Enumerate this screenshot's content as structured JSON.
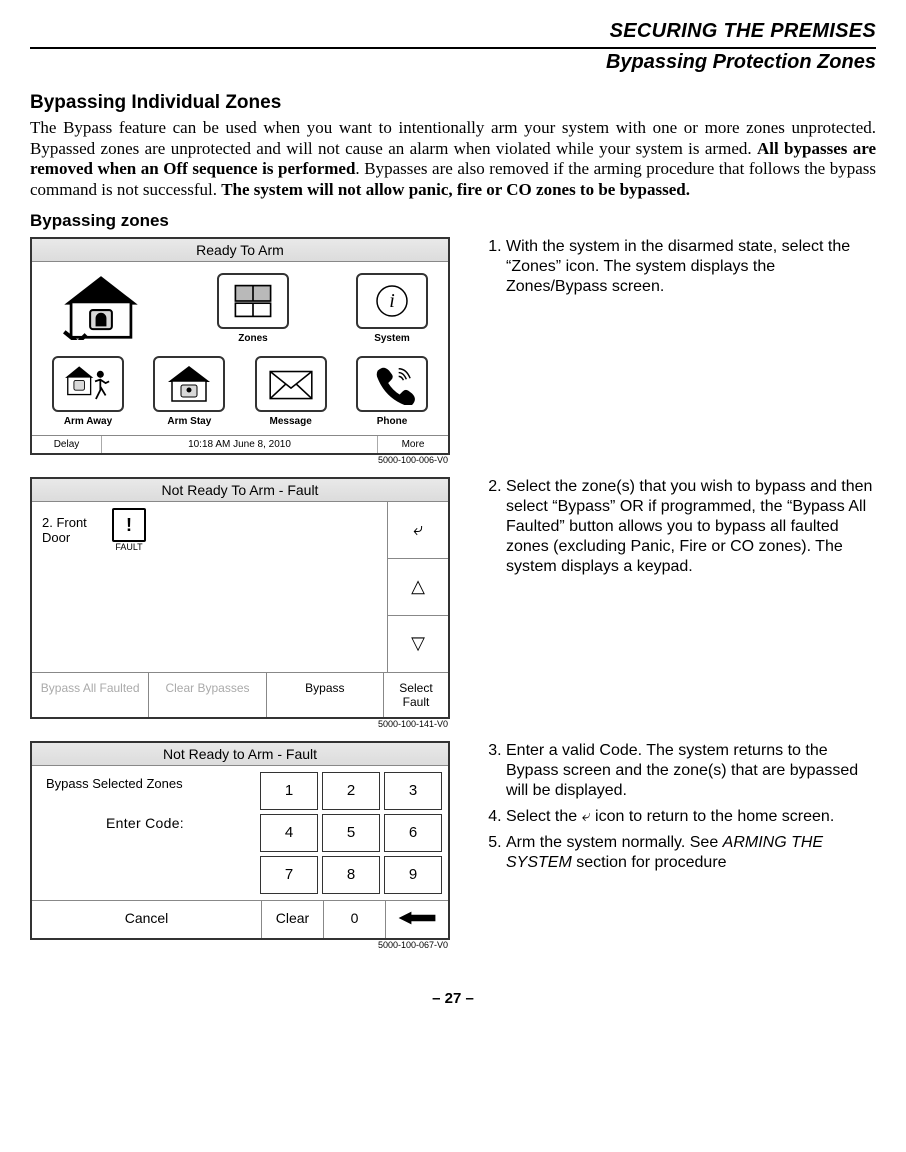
{
  "header": {
    "chapter": "SECURING THE PREMISES",
    "sub": "Bypassing Protection Zones"
  },
  "section_title": "Bypassing Individual Zones",
  "body_pre": "The Bypass feature can be used when you want to intentionally arm your system with one or more zones unprotected. Bypassed zones are unprotected and will not cause an alarm when violated while your system is armed. ",
  "body_bold1": "All bypasses are removed when an Off sequence is performed",
  "body_mid": ". Bypasses are also removed if the arming procedure that follows the bypass command is not successful. ",
  "body_bold2": "The system will not allow panic, fire or CO zones to be bypassed.",
  "subheading": "Bypassing zones",
  "panel1": {
    "title": "Ready To Arm",
    "zones_label": "Zones",
    "system_label": "System",
    "arm_away": "Arm Away",
    "arm_stay": "Arm Stay",
    "message": "Message",
    "phone": "Phone",
    "delay": "Delay",
    "datetime": "10:18 AM  June 8,  2010",
    "more": "More",
    "figcode": "5000-100-006-V0"
  },
  "step1": "With the system in the disarmed state, select the “Zones” icon. The system displays the Zones/Bypass screen.",
  "panel2": {
    "title": "Not Ready To Arm - Fault",
    "zone_name": "2. Front Door",
    "fault_label": "FAULT",
    "bypass_all": "Bypass All Faulted",
    "clear_byp": "Clear Bypasses",
    "bypass": "Bypass",
    "select_fault": "Select Fault",
    "figcode": "5000-100-141-V0"
  },
  "step2": "Select the zone(s) that you wish to bypass and then select “Bypass” OR if programmed, the “Bypass All Faulted” button allows you to bypass all faulted zones (excluding Panic, Fire or CO zones). The system displays a keypad.",
  "panel3": {
    "title": "Not Ready to Arm - Fault",
    "subtitle": "Bypass Selected Zones",
    "enter_code": "Enter Code:",
    "keys": [
      "1",
      "2",
      "3",
      "4",
      "5",
      "6",
      "7",
      "8",
      "9"
    ],
    "cancel": "Cancel",
    "clear": "Clear",
    "zero": "0",
    "figcode": "5000-100-067-V0"
  },
  "step3": "Enter a valid Code. The system returns to the Bypass screen and the zone(s) that are bypassed will be displayed.",
  "step4_pre": "Select the ",
  "step4_post": " icon to return to the home screen.",
  "step5_pre": "Arm the system normally. See ",
  "step5_ital": "ARMING THE SYSTEM",
  "step5_post": " section for procedure",
  "page_num": "– 27 –"
}
